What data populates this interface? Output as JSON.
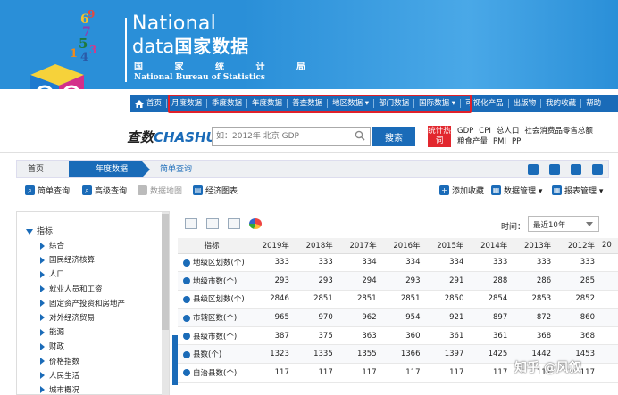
{
  "brand": {
    "line1": "National",
    "line2_en": "data",
    "line2_cn": "国家数据",
    "line3": "国 家 统 计 局",
    "line4": "National Bureau of Statistics",
    "accent": "#1a6bb8",
    "header_bg": "#2a8fd8",
    "highlight_color": "#e0202a"
  },
  "topnav": {
    "items": [
      "首页",
      "月度数据",
      "季度数据",
      "年度数据",
      "普查数据",
      "地区数据 ▾",
      "部门数据",
      "国际数据 ▾",
      "可视化产品",
      "出版物",
      "我的收藏",
      "帮助"
    ]
  },
  "search": {
    "logo_cn": "查数",
    "logo_en": "CHASHU",
    "placeholder": "如：2012年 北京 GDP",
    "button": "搜索",
    "hot_label": "统计热词",
    "hot_words": [
      "GDP",
      "CPI",
      "总人口",
      "社会消费品零售总额",
      "粮食产量",
      "PMI",
      "PPI"
    ]
  },
  "breadcrumb": {
    "home": "首页",
    "current": "年度数据",
    "sub": "简单查询"
  },
  "tools": {
    "simple": "简单查询",
    "advanced": "高级查询",
    "map": "数据地图",
    "chart": "经济图表",
    "favorite": "添加收藏",
    "data_mgmt": "数据管理 ▾",
    "report_mgmt": "报表管理 ▾"
  },
  "tree": {
    "root": "指标",
    "items": [
      "综合",
      "国民经济核算",
      "人口",
      "就业人员和工资",
      "固定资产投资和房地产",
      "对外经济贸易",
      "能源",
      "财政",
      "价格指数",
      "人民生活",
      "城市概况"
    ]
  },
  "time": {
    "label": "时间：",
    "value": "最近10年"
  },
  "table": {
    "headers": [
      "指标",
      "2019年",
      "2018年",
      "2017年",
      "2016年",
      "2015年",
      "2014年",
      "2013年",
      "2012年",
      "20"
    ],
    "rows": [
      {
        "name": "地级区划数(个)",
        "values": [
          "333",
          "333",
          "334",
          "334",
          "334",
          "333",
          "333",
          "333"
        ]
      },
      {
        "name": "地级市数(个)",
        "values": [
          "293",
          "293",
          "294",
          "293",
          "291",
          "288",
          "286",
          "285"
        ]
      },
      {
        "name": "县级区划数(个)",
        "values": [
          "2846",
          "2851",
          "2851",
          "2851",
          "2850",
          "2854",
          "2853",
          "2852"
        ]
      },
      {
        "name": "市辖区数(个)",
        "values": [
          "965",
          "970",
          "962",
          "954",
          "921",
          "897",
          "872",
          "860"
        ]
      },
      {
        "name": "县级市数(个)",
        "values": [
          "387",
          "375",
          "363",
          "360",
          "361",
          "361",
          "368",
          "368"
        ]
      },
      {
        "name": "县数(个)",
        "values": [
          "1323",
          "1335",
          "1355",
          "1366",
          "1397",
          "1425",
          "1442",
          "1453"
        ]
      },
      {
        "name": "自治县数(个)",
        "values": [
          "117",
          "117",
          "117",
          "117",
          "117",
          "117",
          "117",
          "117"
        ]
      }
    ]
  },
  "watermark": "知乎 @风叙"
}
